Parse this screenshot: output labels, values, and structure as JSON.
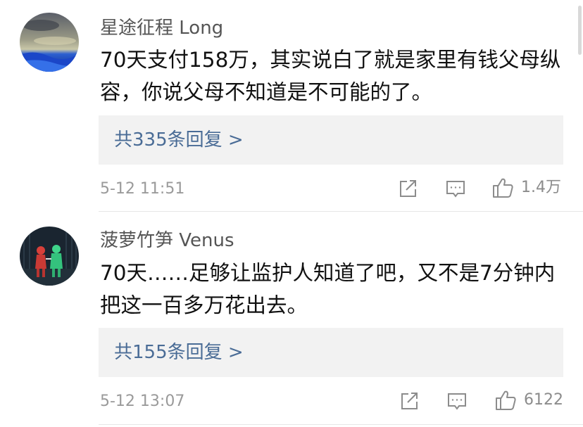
{
  "comments": [
    {
      "username": "星途征程 Long",
      "content": "70天支付158万，其实说白了就是家里有钱父母纵容，你说父母不知道是不可能的了。",
      "replies_label": "共335条回复 >",
      "timestamp": "5-12 11:51",
      "like_count": "1.4万"
    },
    {
      "username": "菠萝竹笋 Venus",
      "content": "70天……足够让监护人知道了吧，又不是7分钟内把这一百多万花出去。",
      "replies_label": "共155条回复 >",
      "timestamp": "5-12 13:07",
      "like_count": "6122"
    }
  ],
  "icons": {
    "share": "share-icon",
    "comment": "comment-icon",
    "like": "thumbs-up-icon"
  },
  "colors": {
    "link": "#4a6c96",
    "meta_text": "#9a9a9a",
    "reply_box_bg": "#f2f2f2",
    "icon_stroke": "#8c8c8c"
  }
}
